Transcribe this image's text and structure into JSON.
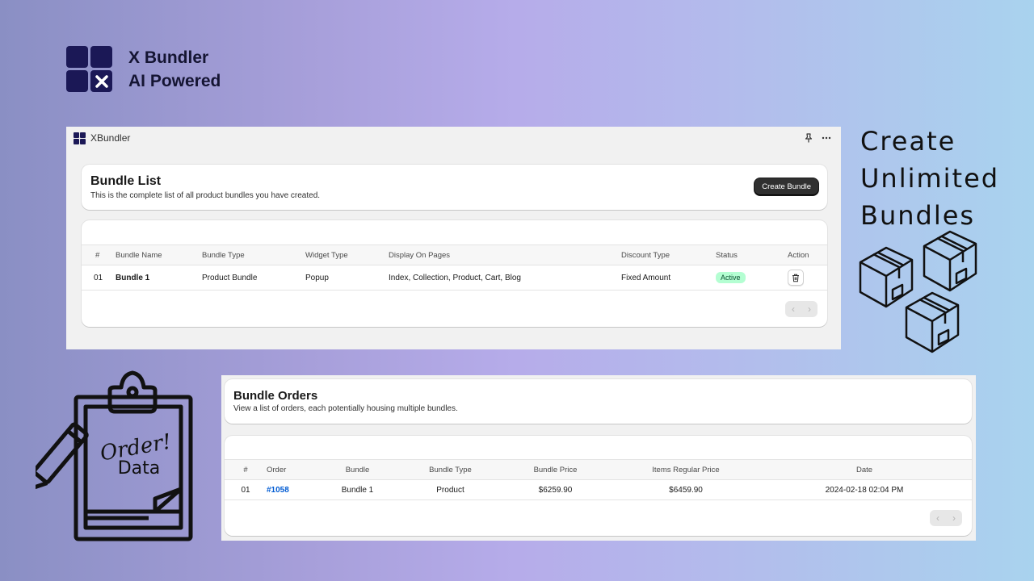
{
  "brand": {
    "line1": "X Bundler",
    "line2": "AI Powered"
  },
  "app": {
    "title": "XBundler"
  },
  "bundle_list": {
    "title": "Bundle List",
    "subtitle": "This is the complete list of all product bundles you have created.",
    "create_label": "Create Bundle",
    "columns": [
      "#",
      "Bundle Name",
      "Bundle Type",
      "Widget Type",
      "Display On Pages",
      "Discount Type",
      "Status",
      "Action"
    ],
    "rows": [
      {
        "num": "01",
        "name": "Bundle 1",
        "type": "Product Bundle",
        "widget": "Popup",
        "pages": "Index, Collection, Product, Cart, Blog",
        "discount": "Fixed Amount",
        "status": "Active"
      }
    ],
    "pager": {
      "prev": "‹",
      "next": "›"
    }
  },
  "bundle_orders": {
    "title": "Bundle Orders",
    "subtitle": "View a list of orders, each potentially housing multiple bundles.",
    "columns": [
      "#",
      "Order",
      "Bundle",
      "Bundle Type",
      "Bundle Price",
      "Items Regular Price",
      "Date"
    ],
    "rows": [
      {
        "num": "01",
        "order": "#1058",
        "bundle": "Bundle 1",
        "type": "Product",
        "price": "$6259.90",
        "regular": "$6459.90",
        "date": "2024-02-18 02:04 PM"
      }
    ],
    "pager": {
      "prev": "‹",
      "next": "›"
    }
  },
  "tagline": {
    "line1": "Create",
    "line2": "Unlimited",
    "line3": "Bundles"
  },
  "clipboard": {
    "line1": "Order!",
    "line2": "Data"
  },
  "icons": {
    "pin": "pin-icon",
    "more": "more-icon",
    "trash": "trash-icon"
  },
  "colors": {
    "brand": "#1b1856",
    "active_badge": "#b4fed2",
    "link": "#005bd3",
    "primary_button": "#303030"
  }
}
